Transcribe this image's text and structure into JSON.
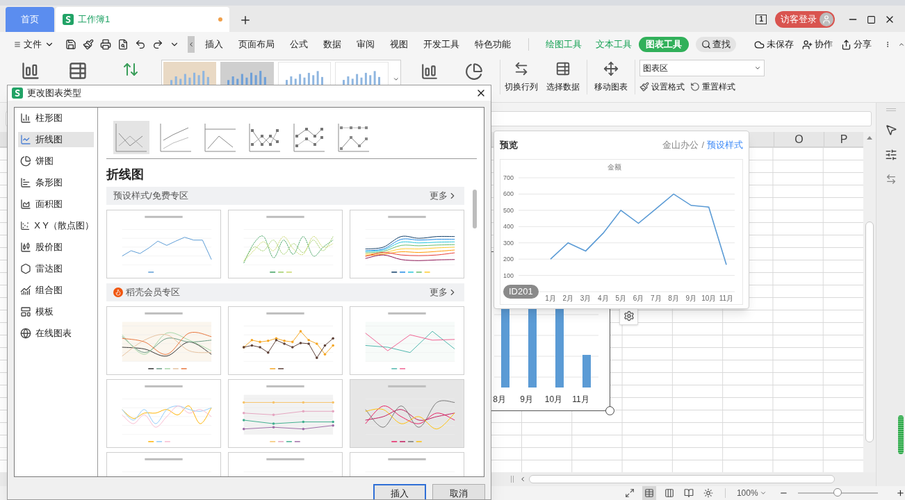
{
  "app_tabs": [
    {
      "label": "首页",
      "kind": "home",
      "selected": false,
      "modified": false
    },
    {
      "label": "工作簿1",
      "kind": "document",
      "selected": true,
      "modified": true
    }
  ],
  "title_bar": {
    "window_count": "1",
    "login_button": "访客登录"
  },
  "menu": {
    "file_menu": "文件",
    "tabs": [
      {
        "label": "插入",
        "kind": "main",
        "selected": false
      },
      {
        "label": "页面布局",
        "kind": "main",
        "selected": false
      },
      {
        "label": "公式",
        "kind": "main",
        "selected": false
      },
      {
        "label": "数据",
        "kind": "main",
        "selected": false
      },
      {
        "label": "审阅",
        "kind": "main",
        "selected": false
      },
      {
        "label": "视图",
        "kind": "main",
        "selected": false
      },
      {
        "label": "开发工具",
        "kind": "main",
        "selected": false
      },
      {
        "label": "特色功能",
        "kind": "main",
        "selected": false
      },
      {
        "label": "绘图工具",
        "kind": "context",
        "selected": false
      },
      {
        "label": "文本工具",
        "kind": "context",
        "selected": false
      },
      {
        "label": "图表工具",
        "kind": "context",
        "selected": true
      }
    ],
    "search": "查找",
    "actions": [
      {
        "label": "未保存",
        "kind": "cloud"
      },
      {
        "label": "协作",
        "kind": "collab"
      },
      {
        "label": "分享",
        "kind": "share"
      }
    ]
  },
  "ribbon": {
    "chart_styles": [
      {
        "selected": false
      },
      {
        "selected": true
      },
      {
        "selected": false
      },
      {
        "selected": false
      }
    ],
    "commands": [
      {
        "label": "切换行列",
        "kind": "switch"
      },
      {
        "label": "选择数据",
        "kind": "data"
      },
      {
        "label": "移动图表",
        "kind": "move"
      }
    ],
    "element_dropdown": {
      "value": "图表区"
    },
    "format_buttons": [
      {
        "label": "设置格式",
        "kind": "format"
      },
      {
        "label": "重置样式",
        "kind": "reset"
      }
    ]
  },
  "sheet": {
    "column_headers": [
      "O",
      "P"
    ],
    "chart_object": {
      "categories": [
        "8月",
        "9月",
        "10月",
        "11月"
      ]
    }
  },
  "dialog": {
    "title": "更改图表类型",
    "chart_types": [
      {
        "label": "柱形图",
        "kind": "column",
        "selected": false
      },
      {
        "label": "折线图",
        "kind": "line",
        "selected": true
      },
      {
        "label": "饼图",
        "kind": "pie",
        "selected": false
      },
      {
        "label": "条形图",
        "kind": "bar",
        "selected": false
      },
      {
        "label": "面积图",
        "kind": "area",
        "selected": false
      },
      {
        "label": "X Y（散点图）",
        "kind": "scatter",
        "selected": false
      },
      {
        "label": "股价图",
        "kind": "stock",
        "selected": false
      },
      {
        "label": "雷达图",
        "kind": "radar",
        "selected": false
      },
      {
        "label": "组合图",
        "kind": "combo",
        "selected": false
      },
      {
        "label": "模板",
        "kind": "template",
        "selected": false
      },
      {
        "label": "在线图表",
        "kind": "online",
        "selected": false
      }
    ],
    "subtypes": [
      {
        "selected": true
      },
      {
        "selected": false
      },
      {
        "selected": false
      },
      {
        "selected": false
      },
      {
        "selected": false
      },
      {
        "selected": false
      }
    ],
    "heading": "折线图",
    "sections": [
      {
        "title": "预设样式/免费专区",
        "more": "更多",
        "kind": "free",
        "templates": [
          {
            "selected": false
          },
          {
            "selected": false
          },
          {
            "selected": false
          }
        ]
      },
      {
        "title": "稻壳会员专区",
        "more": "更多",
        "kind": "member",
        "templates": [
          {
            "selected": false
          },
          {
            "selected": false
          },
          {
            "selected": false
          },
          {
            "selected": false
          },
          {
            "selected": false
          },
          {
            "selected": true
          },
          {
            "selected": false
          },
          {
            "selected": false
          },
          {
            "selected": false
          }
        ]
      }
    ],
    "buttons": [
      {
        "label": "插入",
        "kind": "primary"
      },
      {
        "label": "取消",
        "kind": "normal"
      }
    ]
  },
  "preview": {
    "title": "预览",
    "source": "金山办公",
    "separator": "/",
    "style_link": "预设样式",
    "badge": "ID201",
    "chart_data": {
      "type": "line",
      "title": "金额",
      "categories": [
        "1月",
        "2月",
        "3月",
        "4月",
        "5月",
        "6月",
        "7月",
        "8月",
        "9月",
        "10月",
        "11月"
      ],
      "series": [
        {
          "color": "#5b9bd5",
          "values": [
            200,
            300,
            250,
            360,
            500,
            420,
            510,
            600,
            530,
            520,
            165
          ]
        }
      ],
      "ylim": [
        0,
        700
      ],
      "grid": true,
      "yticks": [
        100,
        200,
        300,
        400,
        500,
        600,
        700
      ]
    }
  },
  "status_bar": {
    "view_buttons": [
      {
        "kind": "fullscreen",
        "selected": false
      },
      {
        "kind": "normal",
        "selected": true
      },
      {
        "kind": "page",
        "selected": false
      },
      {
        "kind": "reading",
        "selected": false
      },
      {
        "kind": "eye",
        "selected": false
      }
    ],
    "zoom": "100%",
    "zoom_slider": {
      "level": 0.5
    }
  }
}
